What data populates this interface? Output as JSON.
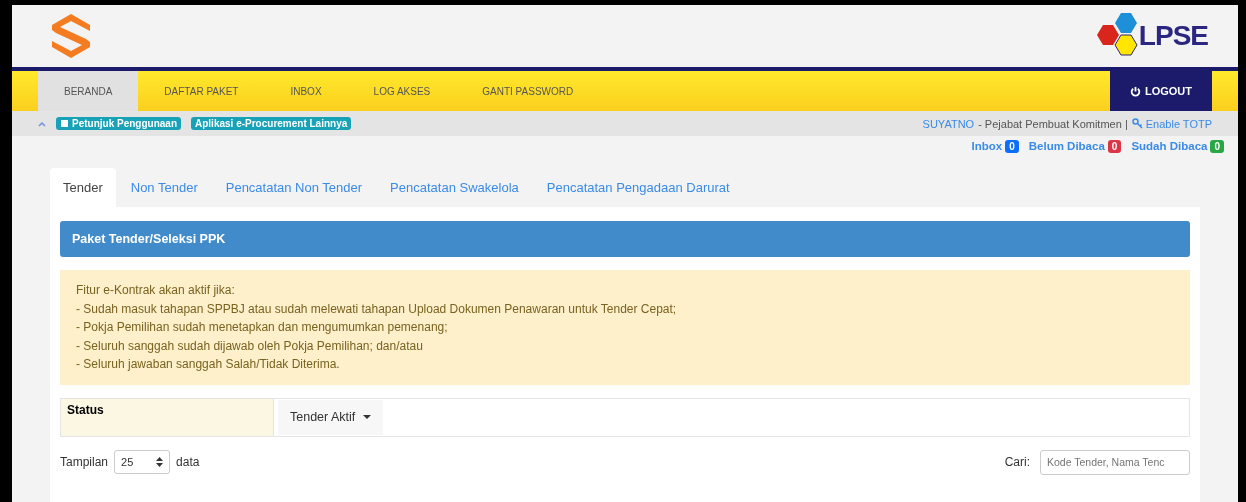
{
  "brand": {
    "logo_text": "LPSE"
  },
  "nav": {
    "items": [
      {
        "label": "BERANDA",
        "selected": true
      },
      {
        "label": "DAFTAR PAKET",
        "selected": false
      },
      {
        "label": "INBOX",
        "selected": false
      },
      {
        "label": "LOG AKSES",
        "selected": false
      },
      {
        "label": "GANTI PASSWORD",
        "selected": false
      }
    ],
    "logout": "LOGOUT"
  },
  "toolbar": {
    "links": [
      "Petunjuk Penggunaan",
      "Aplikasi e-Procurement Lainnya"
    ],
    "user": "SUYATNO",
    "role": "- Pejabat Pembuat Komitmen |",
    "totp": "Enable TOTP"
  },
  "counters": [
    {
      "label": "Inbox",
      "count": "0",
      "color": "#0d6efd"
    },
    {
      "label": "Belum Dibaca",
      "count": "0",
      "color": "#dc3545"
    },
    {
      "label": "Sudah Dibaca",
      "count": "0",
      "color": "#28a745"
    }
  ],
  "tabs": [
    {
      "label": "Tender",
      "selected": true
    },
    {
      "label": "Non Tender",
      "selected": false
    },
    {
      "label": "Pencatatan Non Tender",
      "selected": false
    },
    {
      "label": "Pencatatan Swakelola",
      "selected": false
    },
    {
      "label": "Pencatatan Pengadaan Darurat",
      "selected": false
    }
  ],
  "panel": {
    "title": "Paket Tender/Seleksi PPK"
  },
  "notice": {
    "lines": [
      "Fitur e-Kontrak akan aktif jika:",
      "- Sudah masuk tahapan SPPBJ atau sudah melewati tahapan Upload Dokumen Penawaran untuk Tender Cepat;",
      "- Pokja Pemilihan sudah menetapkan dan mengumumkan pemenang;",
      "- Seluruh sanggah sudah dijawab oleh Pokja Pemilihan; dan/atau",
      "- Seluruh jawaban sanggah Salah/Tidak Diterima."
    ]
  },
  "filter": {
    "label": "Status",
    "value": "Tender Aktif"
  },
  "length": {
    "prefix": "Tampilan",
    "value": "25",
    "suffix": "data"
  },
  "search": {
    "label": "Cari:",
    "placeholder": "Kode Tender, Nama Tenc"
  }
}
